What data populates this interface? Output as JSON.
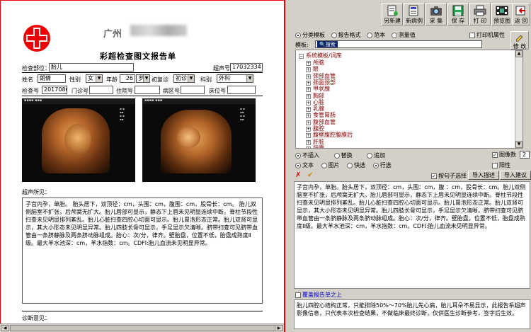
{
  "report": {
    "hospital_name": "广州",
    "title": "彩超检查图文报告单",
    "exam_part_label": "检查部位：",
    "exam_part_value": "胎儿",
    "ultrasound_no_label": "超声号",
    "ultrasound_no_value": "17032334",
    "name_label": "姓名",
    "name_value": "朗倩",
    "gender_label": "性别",
    "gender_value": "女",
    "age_label": "年龄",
    "age_value": "26",
    "age_unit": "岁",
    "visit_label": "初复诊",
    "visit_value": "初诊",
    "dept_label": "科别",
    "dept_value": "外科",
    "exam_no_label": "检查号",
    "exam_no_value": "20170865",
    "outpatient_label": "门诊号",
    "inpatient_label": "住院号",
    "ward_label": "病区号",
    "bed_label": "床位号",
    "findings_label": "超声所见：",
    "findings_text": "子宫内孕，单胎。    胎头居下，双顶径：cm，头围：cm，腹围：cm，股骨长：cm。    胎儿双侧脑室不扩张，后颅窝无扩大。胎儿唇部可显示，静态下上唇未见明显连续中断。脊柱节段性扫查未见明显排列紊乱。胎儿心脏扫查四腔心切面可显示。胎儿胃泡形态正常。胎儿双肾可显示，其大小形态未见明显异常。胎儿四肢长骨可显示，手足显示欠清晰。脐带扫查可见脐带血管由一条脐静脉及两条脐动脉组成。胎心：次/分，律齐。壁胎盘，位置不低，胎盘成熟度Ⅱ级。最大羊水池深：cm，羊水指数：cm。CDFI:胎儿血流未见明显异常。",
    "diagnosis_label": "诊断意见：",
    "image1_header": "▪▪▪▪ ▪▪▪",
    "image2_header": "▪▪▪▪ ▪▪▪"
  },
  "toolbar": {
    "buttons": [
      {
        "label": "另新建",
        "icon": "new-doc-icon"
      },
      {
        "label": "新病例",
        "icon": "new-case-icon"
      },
      {
        "label": "采 集",
        "icon": "camera-icon"
      },
      {
        "label": "保 存",
        "icon": "save-icon"
      },
      {
        "label": "打 印",
        "icon": "print-icon"
      },
      {
        "label": "预览图",
        "icon": "preview-icon"
      },
      {
        "label": "返 回",
        "icon": "return-icon"
      }
    ]
  },
  "template_panel": {
    "radio_category": "分类模板",
    "radio_report_format": "报告格式",
    "radio_sample": "范本",
    "radio_measure": "测量值",
    "print_attr_label": "打印机属性",
    "template_label": "模板:",
    "search_label": "搜索",
    "modify_label": "修 改",
    "tree_root": "系统模板/词库",
    "tree_items": [
      "颅脑",
      "眼",
      "颈部血管",
      "颈面颈部",
      "甲状腺",
      "胸部",
      "心脏",
      "乳腺",
      "食管胃肠",
      "腹部血管",
      "腹腔",
      "腹壁腹腔腹膜后",
      "肝脏",
      "胆囊"
    ]
  },
  "insert_options": {
    "no_insert": "不插入",
    "replace": "替换",
    "append": "追加",
    "image_count_label": "图像数",
    "image_count_value": "2",
    "text": "文本",
    "image": "图片",
    "quick_select": "快选",
    "line_select": "行选",
    "positive": "阳性",
    "line_choose": "按句子选择",
    "import_desc_btn": "导入描述",
    "import_advice_btn": "导入建议"
  },
  "description_text": "子宫内孕，单胎。胎头居下，双顶径：cm，头围：cm，腹  ：cm，股骨长：cm。胎儿双侧脑室不扩张，后颅窝无扩大。胎儿唇部可显示，静态下上唇未见明显连续中断。脊柱节段性扫查未见明显排列紊乱。胎儿心脏扫查四腔心切面可显示。胎儿胃泡形态正常。胎儿双肾可显示，其大小形态未见明显异常。胎儿四肢长骨可显示，手足显示欠清晰。脐带扫查可见脐带血管由一条脐静脉及两条脐动脉组成。胎心：次/分，律齐。壁胎盘，位置不低，胎盘成熟度Ⅱ级。最大羊水池深：cm，羊水指数：cm。CDFI:胎儿血流未见明显异常。",
  "overwrite_label": "覆盖报告单之上",
  "advice_text": "胎儿四腔心结构正常，只能排除50%～70%胎儿先心病，胎儿耳朵不易显示，此报告系超声影像信息，只代表本次检查结果，不做临床最终诊断，仅供医生诊断参考，签字后生效。"
}
